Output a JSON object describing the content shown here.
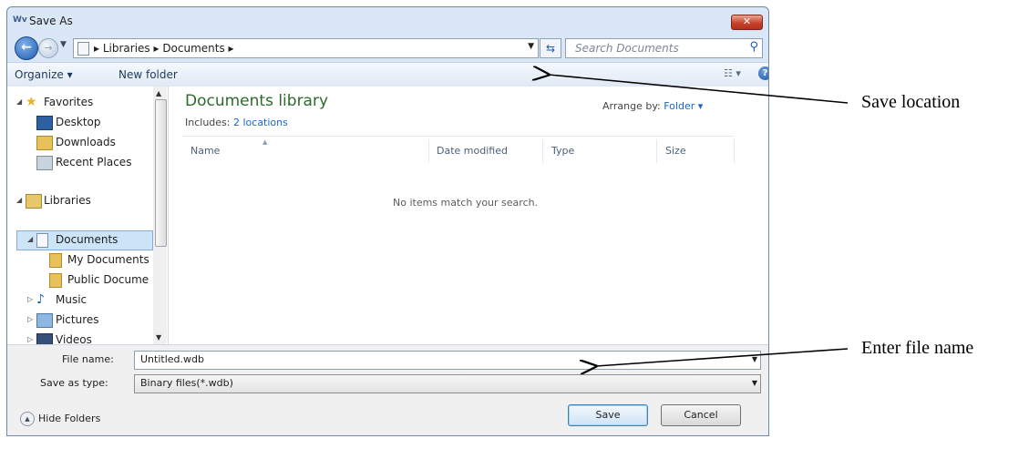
{
  "window": {
    "title": "Save As",
    "app_icon_text": "Wv",
    "close_label": "✕"
  },
  "address_bar": {
    "crumbs": "▸  Libraries  ▸  Documents  ▸",
    "search_placeholder": "Search Documents"
  },
  "toolbar": {
    "organize_label": "Organize ▾",
    "new_folder_label": "New folder",
    "views_label": "☷ ▾",
    "help_label": "?"
  },
  "nav_pane": {
    "items": [
      {
        "label": "Favorites",
        "icon": "star-icon"
      },
      {
        "label": "Desktop",
        "icon": "desktop-icon"
      },
      {
        "label": "Downloads",
        "icon": "downloads-folder-icon"
      },
      {
        "label": "Recent Places",
        "icon": "recent-places-icon"
      },
      {
        "label": "Libraries",
        "icon": "libraries-icon"
      },
      {
        "label": "Documents",
        "icon": "documents-icon",
        "selected": true
      },
      {
        "label": "My Documents",
        "icon": "folder-icon"
      },
      {
        "label": "Public Docume",
        "icon": "folder-icon"
      },
      {
        "label": "Music",
        "icon": "music-icon"
      },
      {
        "label": "Pictures",
        "icon": "pictures-icon"
      },
      {
        "label": "Videos",
        "icon": "videos-icon"
      }
    ]
  },
  "content": {
    "library_title": "Documents library",
    "includes_prefix": "Includes:",
    "includes_link": "2 locations",
    "arrange_by_label": "Arrange by:",
    "arrange_by_value": "Folder ▾",
    "columns": [
      "Name",
      "Date modified",
      "Type",
      "Size"
    ],
    "empty_message": "No items match your search."
  },
  "form": {
    "file_name_label": "File name:",
    "file_name_value": "Untitled.wdb",
    "save_type_label": "Save as type:",
    "save_type_value": "Binary files(*.wdb)",
    "hide_folders_label": "Hide Folders",
    "save_button": "Save",
    "cancel_button": "Cancel"
  },
  "annotations": {
    "save_location": "Save location",
    "enter_file_name": "Enter file name"
  },
  "colors": {
    "library_title": "#2b6a2b",
    "link": "#1b66c4",
    "close_button": "#c8432c",
    "window_frame": "#d9e7f6"
  }
}
